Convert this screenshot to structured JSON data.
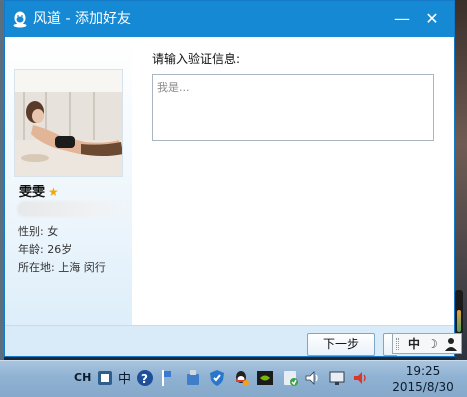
{
  "window": {
    "title": "风道 - 添加好友",
    "min_label": "—",
    "close_label": "✕"
  },
  "profile": {
    "nickname": "雯雯",
    "gender": "性别: 女",
    "age": "年龄: 26岁",
    "location": "所在地: 上海  闵行"
  },
  "form": {
    "prompt": "请输入验证信息:",
    "verify_placeholder": "我是..."
  },
  "footer": {
    "next_label": "下一步"
  },
  "ime": {
    "mode": "中",
    "moon": "☽"
  },
  "volume_level": 0.55,
  "taskbar": {
    "lang": "CH",
    "time": "19:25",
    "date": "2015/8/30",
    "tray_icons": [
      "keyboard-icon",
      "ime-zh-icon",
      "help-icon",
      "network-flag-icon",
      "usb-icon",
      "shield-icon",
      "qq-icon",
      "nvidia-icon",
      "security-check-icon",
      "speaker-icon",
      "display-icon",
      "volume-icon"
    ]
  },
  "colors": {
    "titlebar": "#1589d3",
    "footer": "#d9ebf8",
    "taskbar": "#8fb1d2",
    "star": "#f2a900"
  }
}
